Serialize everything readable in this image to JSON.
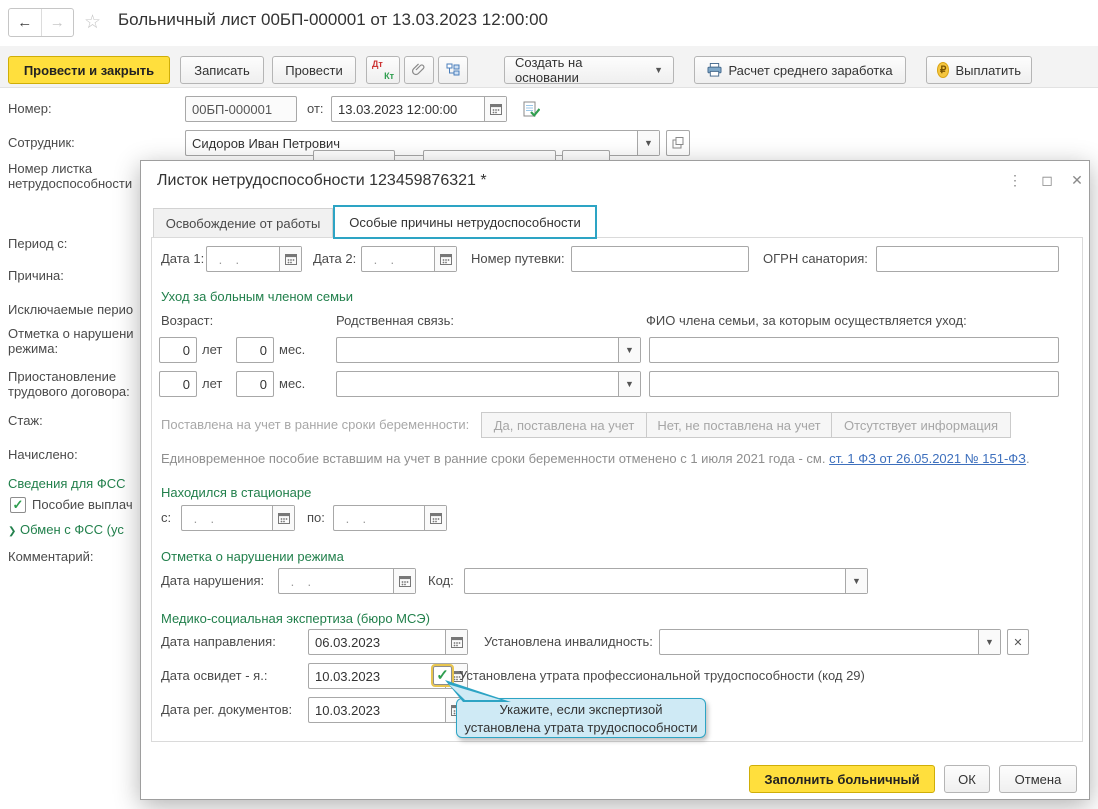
{
  "main": {
    "title": "Больничный лист 00БП-000001 от 13.03.2023 12:00:00",
    "toolbar": {
      "post_and_close": "Провести и закрыть",
      "save": "Записать",
      "post": "Провести",
      "dt": "Дт",
      "kt": "Кт",
      "create_based_on": "Создать на основании",
      "avg_earnings": "Расчет среднего заработка",
      "pay": "Выплатить",
      "ruble_sign": "₽"
    },
    "form": {
      "number_label": "Номер:",
      "number_value": "00БП-000001",
      "from_label": "от:",
      "doc_datetime": "13.03.2023 12:00:00",
      "employee_label": "Сотрудник:",
      "employee_value": "Сидоров Иван Петрович",
      "sick_number_label_line1": "Номер листка",
      "sick_number_label_line2": "нетрудоспособности",
      "period_label": "Период с:",
      "reason_label": "Причина:",
      "excluded_label": "Исключаемые перио",
      "violation_line1": "Отметка о нарушени",
      "violation_line2": "режима:",
      "suspension_line1": "Приостановление",
      "suspension_line2": "трудового договора:",
      "seniority_label": "Стаж:",
      "accrued_label": "Начислено:",
      "fss_header": "Сведения для ФСС",
      "benefit_paid_check": "✓",
      "benefit_paid_label": "Пособие выплач",
      "fss_exchange_chevron": "❯",
      "fss_exchange_label": "Обмен с ФСС (ус",
      "comment_label": "Комментарий:"
    }
  },
  "dialog": {
    "title": "Листок нетрудоспособности 123459876321 *",
    "controls": {
      "menu": "⋮",
      "maximize": "◻",
      "close": "✕"
    },
    "tabs": {
      "tab1": "Освобождение от работы",
      "tab2": "Особые причины нетрудоспособности"
    },
    "row1": {
      "date1_label": "Дата 1:",
      "date2_label": "Дата 2:",
      "empty_date_placeholder": " .  .",
      "voucher_label": "Номер путевки:",
      "ogrn_label": "ОГРН санатория:"
    },
    "care": {
      "header": "Уход за больным членом семьи",
      "age_label": "Возраст:",
      "relation_label": "Родственная связь:",
      "fio_label": "ФИО члена семьи, за которым осуществляется уход:",
      "years_suffix": "лет",
      "months_suffix": "мес.",
      "rows": [
        {
          "years": "0",
          "months": "0"
        },
        {
          "years": "0",
          "months": "0"
        }
      ]
    },
    "pregnancy": {
      "label": "Поставлена на учет в ранние сроки беременности:",
      "yes_btn": "Да, поставлена на учет",
      "no_btn": "Нет, не поставлена на учет",
      "unknown_btn": "Отсутствует информация",
      "note_text": "Единовременное пособие вставшим на учет в ранние сроки беременности отменено с 1 июля 2021 года - см. ",
      "note_link": "ст. 1 ФЗ от 26.05.2021 № 151-ФЗ",
      "note_suffix": "."
    },
    "hospital": {
      "header": "Находился в стационаре",
      "from_label": "с:",
      "to_label": "по:"
    },
    "violation": {
      "header": "Отметка о нарушении режима",
      "date_label": "Дата нарушения:",
      "code_label": "Код:"
    },
    "mse": {
      "header": "Медико-социальная экспертиза (бюро МСЭ)",
      "direction_label": "Дата направления:",
      "direction_value": "06.03.2023",
      "disability_label": "Установлена инвалидность:",
      "exam_label": "Дата освидет - я.:",
      "exam_value": "10.03.2023",
      "loss_check": "✓",
      "loss_label": "Установлена утрата профессиональной трудоспособности (код 29)",
      "reg_label": "Дата рег. документов:",
      "reg_value": "10.03.2023"
    },
    "tooltip": {
      "line1": "Укажите, если экспертизой",
      "line2": "установлена утрата трудоспособности"
    },
    "footer": {
      "fill_btn": "Заполнить больничный",
      "ok_btn": "ОК",
      "cancel_btn": "Отмена"
    }
  },
  "colors": {
    "accent_yellow": "#ffdf3d",
    "section_green": "#22804c",
    "tab_active_border": "#2da4c4",
    "tooltip_bg": "#cfeaf5",
    "link_blue": "#3e70bd",
    "check_green": "#2f9e4f",
    "dt_red": "#cc3333"
  }
}
